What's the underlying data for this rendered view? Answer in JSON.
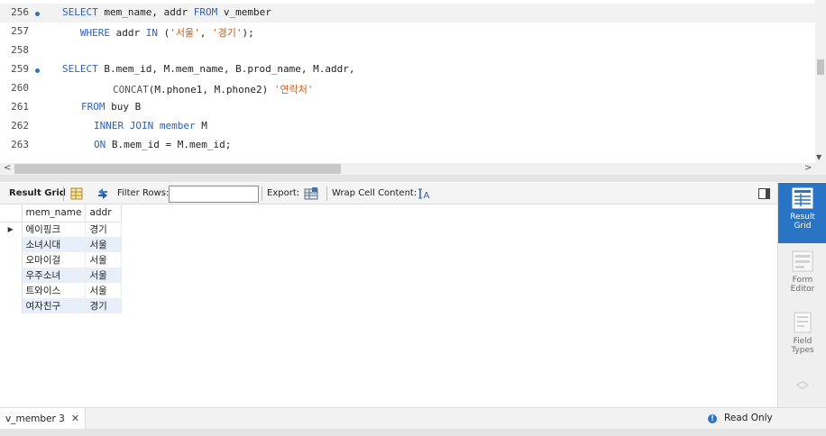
{
  "editor": {
    "lines": [
      {
        "num": "256",
        "bullet": true
      },
      {
        "num": "257",
        "bullet": false
      },
      {
        "num": "258",
        "bullet": false
      },
      {
        "num": "259",
        "bullet": true
      },
      {
        "num": "260",
        "bullet": false
      },
      {
        "num": "261",
        "bullet": false
      },
      {
        "num": "262",
        "bullet": false
      },
      {
        "num": "263",
        "bullet": false
      }
    ],
    "code": {
      "l256": {
        "kw1": "SELECT",
        "t1": " mem_name, addr ",
        "kw2": "FROM",
        "t2": " v_member"
      },
      "l257": {
        "kw1": "WHERE",
        "t1": " addr ",
        "kw2": "IN",
        "t2": " (",
        "s1": "'서울'",
        "t3": ", ",
        "s2": "'경기'",
        "t4": ");"
      },
      "l259": {
        "kw1": "SELECT",
        "t1": " B.mem_id, M.mem_name, B.prod_name, M.addr,"
      },
      "l260": {
        "fn": "CONCAT",
        "t1": "(M.phone1, M.phone2) ",
        "s1": "'연락처'"
      },
      "l261": {
        "kw1": "FROM",
        "t1": " buy B"
      },
      "l262": {
        "kw1": "INNER JOIN",
        "t1": " ",
        "kw2": "member",
        "t2": " M"
      },
      "l263": {
        "kw1": "ON",
        "t1": " B.mem_id = M.mem_id;"
      }
    }
  },
  "toolbar": {
    "result_grid_label": "Result Grid",
    "filter_rows_label": "Filter Rows:",
    "filter_value": "",
    "export_label": "Export:",
    "wrap_label": "Wrap Cell Content:"
  },
  "grid": {
    "columns": [
      "mem_name",
      "addr"
    ],
    "rows": [
      [
        "에이핑크",
        "경기"
      ],
      [
        "소녀시대",
        "서울"
      ],
      [
        "오마이걸",
        "서울"
      ],
      [
        "우주소녀",
        "서울"
      ],
      [
        "트와이스",
        "서울"
      ],
      [
        "여자친구",
        "경기"
      ]
    ],
    "current_row_marker": "▶"
  },
  "sidepanel": {
    "result_grid": {
      "line1": "Result",
      "line2": "Grid"
    },
    "form_editor": {
      "line1": "Form",
      "line2": "Editor"
    },
    "field_types": {
      "line1": "Field",
      "line2": "Types"
    }
  },
  "bottom": {
    "tab_label": "v_member 3",
    "tab_close": "✕",
    "status_text": "Read Only",
    "status_icon": "!"
  },
  "colors": {
    "accent": "#2a74c6",
    "keyword": "#2d5fb8",
    "string": "#c25b1b",
    "selection": "#7fb0e0"
  }
}
